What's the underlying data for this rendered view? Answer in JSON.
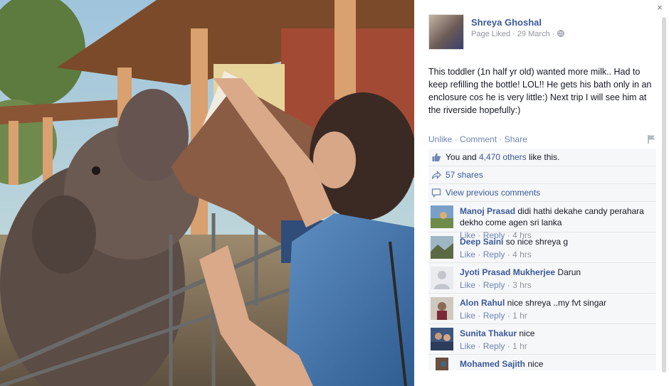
{
  "page": {
    "name": "Shreya Ghoshal",
    "meta_liked": "Page Liked",
    "meta_date": "29 March",
    "meta_sep": "·"
  },
  "post": {
    "text": "This toddler (1n half yr old) wanted more milk.. Had to keep refilling the bottle! LOL!! He gets his bath only in an enclosure cos he is very little:) Next trip I will see him at the riverside hopefully:)"
  },
  "actions": {
    "unlike": "Unlike",
    "comment": "Comment",
    "share": "Share",
    "sep": "·"
  },
  "likes": {
    "you_and": "You and",
    "others": "4,470 others",
    "suffix": "like this."
  },
  "shares": {
    "label": "57 shares"
  },
  "view_previous": {
    "label": "View previous comments"
  },
  "comments": [
    {
      "name": "Manoj Prasad",
      "text": "didi hathi dekahe candy perahara dekho come agen sri lanka",
      "like": "Like",
      "reply": "Reply",
      "time": "4 hrs"
    },
    {
      "name": "Deep Saini",
      "text": "so nice shreya g",
      "like": "Like",
      "reply": "Reply",
      "time": "4 hrs"
    },
    {
      "name": "Jyoti Prasad Mukherjee",
      "text": "Darun",
      "like": "Like",
      "reply": "Reply",
      "time": "3 hrs"
    },
    {
      "name": "Alon Rahul",
      "text": "nice shreya ..my fvt singar",
      "like": "Like",
      "reply": "Reply",
      "time": "1 hr"
    },
    {
      "name": "Sunita Thakur",
      "text": "nice",
      "like": "Like",
      "reply": "Reply",
      "time": "1 hr"
    },
    {
      "name": "Mohamed Sajith",
      "text": "nice",
      "like": "",
      "reply": "",
      "time": ""
    }
  ],
  "close_label": "×",
  "icons": {
    "close": "close-icon",
    "globe": "globe-icon",
    "flag": "flag-icon",
    "thumb": "thumbs-up-icon",
    "share": "share-icon",
    "comment": "comment-icon"
  }
}
